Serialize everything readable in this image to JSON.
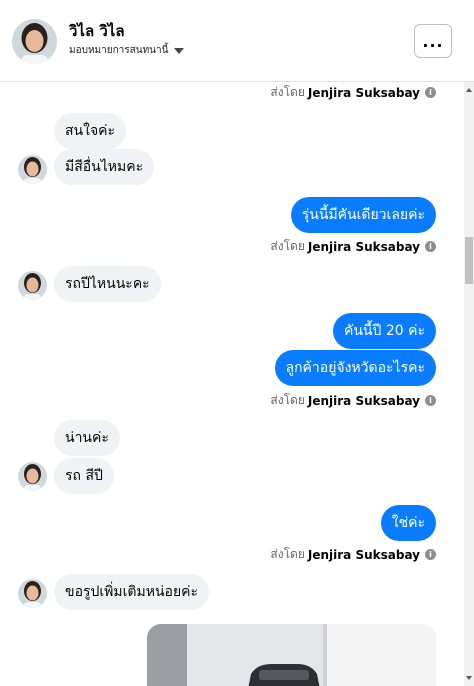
{
  "header": {
    "name": "วิไล วิไล",
    "subtitle": "มอบหมายการสนทนานี้",
    "more_label": "..."
  },
  "sent_by": {
    "prefix": "ส่งโดย",
    "author": "Jenjira Suksabay"
  },
  "messages": [
    {
      "dir": "in",
      "text": "สนใจค่ะ"
    },
    {
      "dir": "in",
      "text": "มีสีอื่นไหมคะ"
    },
    {
      "dir": "out",
      "text": "รุ่นนี้มีคันเดียวเลยค่ะ"
    },
    {
      "dir": "in",
      "text": "รถปีไหนนะคะ"
    },
    {
      "dir": "out",
      "text": "คันนี้ปี 20 ค่ะ"
    },
    {
      "dir": "out",
      "text": "ลูกค้าอยู่จังหวัดอะไรคะ"
    },
    {
      "dir": "in",
      "text": "น่านค่ะ"
    },
    {
      "dir": "in",
      "text": "รถ สีปี"
    },
    {
      "dir": "out",
      "text": "ใช่ค่ะ"
    },
    {
      "dir": "in",
      "text": "ขอรูปเพิ่มเติมหน่อยค่ะ"
    }
  ],
  "colors": {
    "outgoing_bubble": "#0a7cff",
    "incoming_bubble": "#f0f2f5",
    "meta_text": "#65676b"
  }
}
